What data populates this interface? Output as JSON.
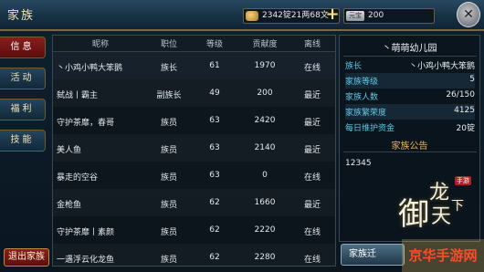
{
  "header": {
    "title": "家族",
    "gold_text": "2342锭21两68文",
    "gem_text": "200",
    "gem_icon_text": "元宝"
  },
  "tabs": [
    {
      "label": "信息",
      "active": true
    },
    {
      "label": "活动",
      "active": false
    },
    {
      "label": "福利",
      "active": false
    },
    {
      "label": "技能",
      "active": false
    }
  ],
  "exit_button": "退出家族",
  "table": {
    "headers": [
      "昵称",
      "职位",
      "等级",
      "贡献度",
      "离线"
    ],
    "rows": [
      {
        "name": "丶小鸡小鸭大笨鹅",
        "position": "族长",
        "level": "61",
        "contribution": "1970",
        "status": "在线"
      },
      {
        "name": "弑战丨霸主",
        "position": "副族长",
        "level": "49",
        "contribution": "200",
        "status": "最近"
      },
      {
        "name": "守护茶靡，春哥",
        "position": "族员",
        "level": "63",
        "contribution": "2420",
        "status": "最近"
      },
      {
        "name": "美人鱼",
        "position": "族员",
        "level": "63",
        "contribution": "2140",
        "status": "最近"
      },
      {
        "name": "暴走的空谷",
        "position": "族员",
        "level": "63",
        "contribution": "0",
        "status": "在线"
      },
      {
        "name": "金枪鱼",
        "position": "族员",
        "level": "62",
        "contribution": "1660",
        "status": "最近"
      },
      {
        "name": "守护茶靡丨素颜",
        "position": "族员",
        "level": "62",
        "contribution": "2220",
        "status": "在线"
      },
      {
        "name": "一遇浮云化龙鱼",
        "position": "族员",
        "level": "62",
        "contribution": "2280",
        "status": "在线"
      }
    ]
  },
  "guild": {
    "name": "丶萌萌幼儿园",
    "info": [
      {
        "label": "族长",
        "value": "丶小鸡小鸭大笨鹅"
      },
      {
        "label": "家族等级",
        "value": "5"
      },
      {
        "label": "家族人数",
        "value": "26/150"
      },
      {
        "label": "家族繁荣度",
        "value": "4125"
      },
      {
        "label": "每日维护资金",
        "value": "20锭"
      }
    ],
    "notice_title": "家族公告",
    "notice_text": "12345"
  },
  "bottom_button": "家族迁",
  "emblem": {
    "chars": [
      "御",
      "龙",
      "天",
      "下"
    ],
    "badge": "手游"
  },
  "watermark": "京华手游网"
}
